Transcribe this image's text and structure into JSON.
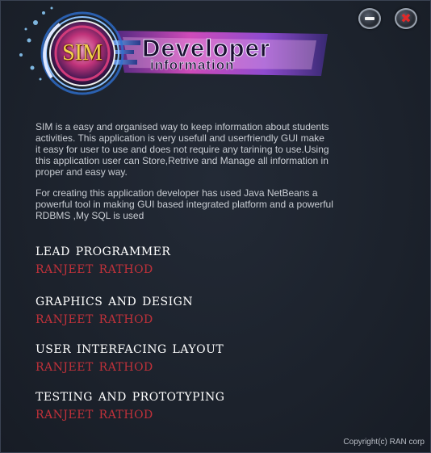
{
  "logo": {
    "mark": "SIM",
    "title_line1": "Developer",
    "title_line2": "information"
  },
  "controls": {
    "minimize_icon": "minimize-icon",
    "close_icon": "close-icon",
    "close_color": "#e02828"
  },
  "description": {
    "paragraph1": "SIM is a easy and organised way to keep information about students\n activities. This application is very usefull and userfriendly GUI make\n it easy for user to use and does not require any tarining to use.Using\nthis application user can Store,Retrive and Manage all information in\nproper and easy way.",
    "paragraph2": " For creating this  application developer has used Java NetBeans a\n powerful tool in making GUI based integrated platform and a powerful\nRDBMS ,My SQL is used"
  },
  "credits": [
    {
      "role": "Lead Programmer",
      "name": "Ranjeet Rathod"
    },
    {
      "role": "Graphics and Design",
      "name": "Ranjeet Rathod"
    },
    {
      "role": "User Interfacing Layout",
      "name": "Ranjeet Rathod"
    },
    {
      "role": "Testing and Prototyping",
      "name": "Ranjeet Rathod"
    }
  ],
  "footer": {
    "copyright": "Copyright(c) RAN corp"
  },
  "colors": {
    "background": "#1c222c",
    "role_text": "#ffffff",
    "name_text": "#c0313a",
    "body_text": "#c9cdd3"
  }
}
